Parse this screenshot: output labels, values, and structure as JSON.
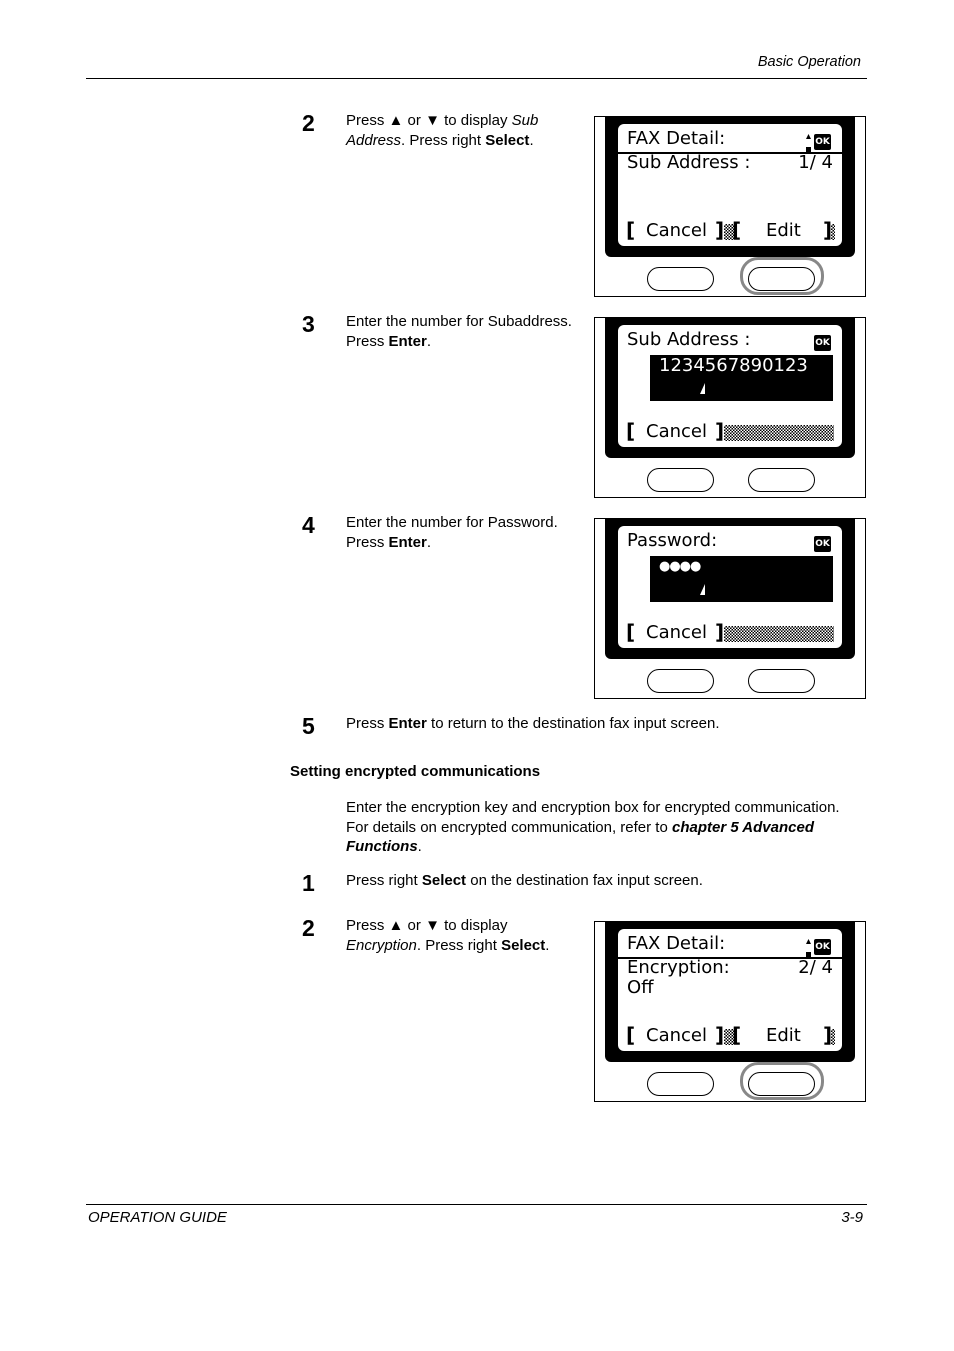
{
  "header": {
    "section": "Basic Operation"
  },
  "footer": {
    "guide": "OPERATION GUIDE",
    "page": "3-9"
  },
  "steps_a": [
    {
      "num": "2",
      "lines": [
        [
          "Press ",
          "▲",
          " or ",
          "▼",
          " to display ",
          "Sub"
        ],
        [
          "Address",
          ". Press right ",
          "Select",
          "."
        ]
      ]
    },
    {
      "num": "3",
      "line1": "Enter the number for Subaddress.",
      "line2_pre": "Press ",
      "line2_bold": "Enter",
      "line2_post": "."
    },
    {
      "num": "4",
      "line1": "Enter the number for Password.",
      "line2_pre": "Press ",
      "line2_bold": "Enter",
      "line2_post": "."
    },
    {
      "num": "5",
      "pre": "Press ",
      "bold": "Enter",
      "post": " to return to the destination fax input screen."
    }
  ],
  "section": {
    "title": "Setting encrypted communications",
    "para_1": "Enter the encryption key and encryption box for encrypted communication.",
    "para_2_pre": "For details on encrypted communication, refer to ",
    "para_2_ref": "chapter 5 Advanced Functions",
    "para_2_post": "."
  },
  "steps_b": [
    {
      "num": "1",
      "pre": "Press right ",
      "bold": "Select",
      "post": " on the destination fax input screen."
    },
    {
      "num": "2",
      "l1_pre": "Press ",
      "up": "▲",
      "or": " or ",
      "down": "▼",
      "l1_post": " to display",
      "l2_it": "Encryption",
      "l2_mid": ". Press right ",
      "l2_bold": "Select",
      "l2_post": "."
    }
  ],
  "panels": {
    "fax_detail_subaddress": {
      "title": "FAX Detail:",
      "ok": "OK",
      "item": "Sub Address :",
      "counter": "1/ 4",
      "value": "",
      "left_key": "Cancel",
      "right_key": "Edit"
    },
    "subaddress_entry": {
      "title": "Sub Address :",
      "ok": "OK",
      "input_value": "1234567890123",
      "left_key": "Cancel"
    },
    "password_entry": {
      "title": "Password:",
      "ok": "OK",
      "input_value": "●●●●",
      "left_key": "Cancel"
    },
    "fax_detail_encryption": {
      "title": "FAX Detail:",
      "ok": "OK",
      "item": "Encryption:",
      "counter": "2/ 4",
      "value": "Off",
      "left_key": "Cancel",
      "right_key": "Edit"
    }
  }
}
